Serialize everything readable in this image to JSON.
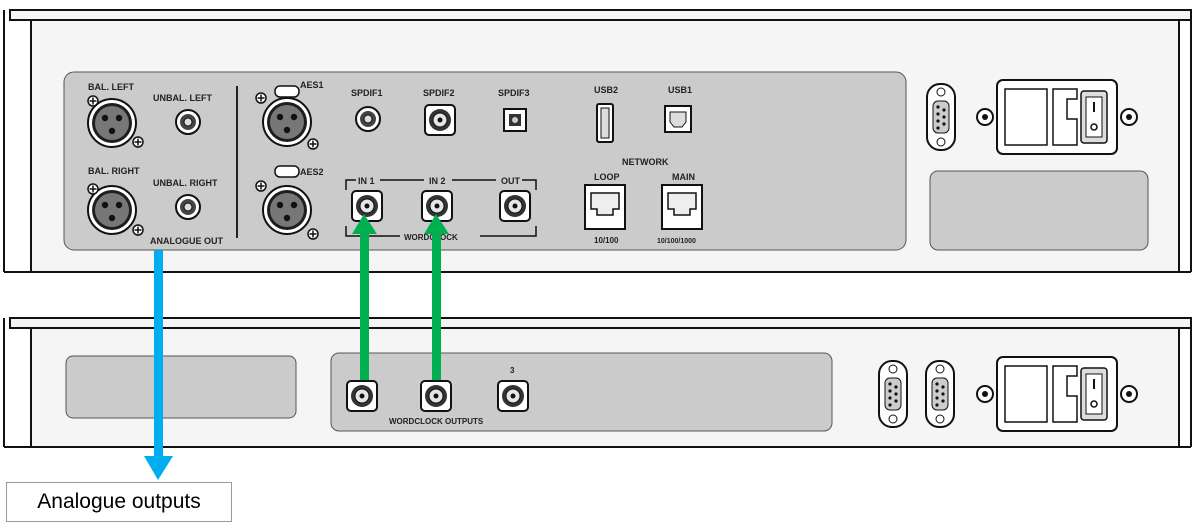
{
  "colors": {
    "chassis": "#f7f7f7",
    "panel": "#c9c9c9",
    "outline": "#1a1a1a",
    "analogue_arrow": "#00aeef",
    "wordclock_arrow": "#00b050"
  },
  "top_unit": {
    "bal_left": "BAL. LEFT",
    "unbal_left": "UNBAL. LEFT",
    "bal_right": "BAL. RIGHT",
    "unbal_right": "UNBAL. RIGHT",
    "analogue_out": "ANALOGUE OUT",
    "aes1": "AES1",
    "aes2": "AES2",
    "spdif1": "SPDIF1",
    "spdif2": "SPDIF2",
    "spdif3": "SPDIF3",
    "usb2": "USB2",
    "usb1": "USB1",
    "network": "NETWORK",
    "loop": "LOOP",
    "main": "MAIN",
    "loop_speed": "10/100",
    "main_speed": "10/100/1000",
    "wc_in1": "IN 1",
    "wc_in2": "IN 2",
    "wc_out": "OUT",
    "wordclock": "WORDCLOCK"
  },
  "bottom_unit": {
    "output3": "3",
    "wordclock_outputs": "WORDCLOCK OUTPUTS"
  },
  "callout": {
    "analogue_outputs": "Analogue outputs"
  }
}
